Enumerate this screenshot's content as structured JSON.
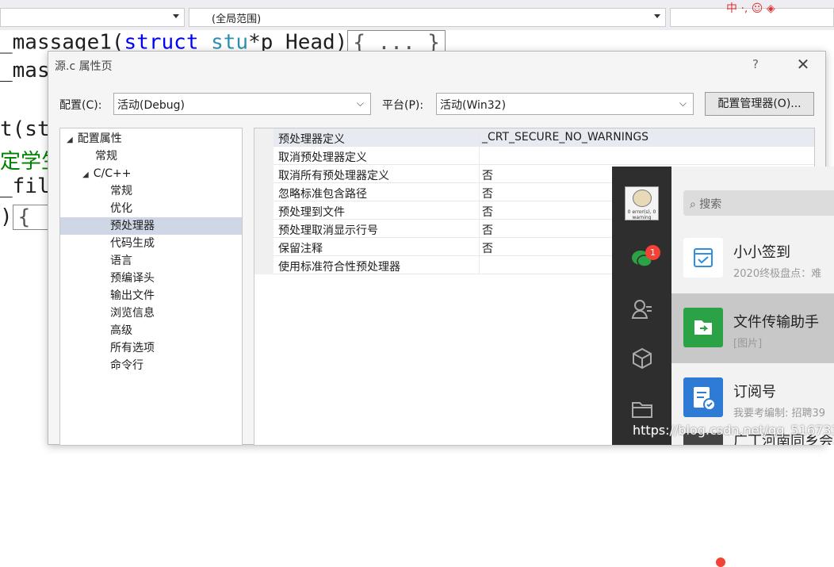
{
  "editor": {
    "scope_combo": "(全局范围)",
    "csdn_badge": "中 ·, ☺ ◈",
    "lines": [
      {
        "text": "_massage1(",
        "kw": "struct",
        "ty": "stu",
        "rest": "*p_Head)",
        "fold": "{ ... }"
      },
      {
        "text": "_mas"
      },
      {
        "text": "t(stu"
      },
      {
        "text": "定学生"
      },
      {
        "text": "_file"
      },
      {
        "text": ")",
        "fold": "{"
      }
    ]
  },
  "dialog": {
    "title": "源.c 属性页",
    "help": "?",
    "close": "✕",
    "config_label": "配置(C):",
    "config_value": "活动(Debug)",
    "platform_label": "平台(P):",
    "platform_value": "活动(Win32)",
    "config_manager_button": "配置管理器(O)...",
    "tree": [
      {
        "label": "配置属性",
        "level": 0,
        "expanded": true
      },
      {
        "label": "常规",
        "level": 1
      },
      {
        "label": "C/C++",
        "level": 1,
        "expanded": true
      },
      {
        "label": "常规",
        "level": 2
      },
      {
        "label": "优化",
        "level": 2
      },
      {
        "label": "预处理器",
        "level": 2,
        "selected": true
      },
      {
        "label": "代码生成",
        "level": 2
      },
      {
        "label": "语言",
        "level": 2
      },
      {
        "label": "预编译头",
        "level": 2
      },
      {
        "label": "输出文件",
        "level": 2
      },
      {
        "label": "浏览信息",
        "level": 2
      },
      {
        "label": "高级",
        "level": 2
      },
      {
        "label": "所有选项",
        "level": 2
      },
      {
        "label": "命令行",
        "level": 2
      }
    ],
    "properties": [
      {
        "name": "预处理器定义",
        "value": "_CRT_SECURE_NO_WARNINGS"
      },
      {
        "name": "取消预处理器定义",
        "value": ""
      },
      {
        "name": "取消所有预处理器定义",
        "value": "否"
      },
      {
        "name": "忽略标准包含路径",
        "value": "否"
      },
      {
        "name": "预处理到文件",
        "value": "否"
      },
      {
        "name": "预处理取消显示行号",
        "value": "否"
      },
      {
        "name": "保留注释",
        "value": "否"
      },
      {
        "name": "使用标准符合性预处理器",
        "value": ""
      }
    ]
  },
  "wechat": {
    "avatar_caption": "0 error(s), 0 warning",
    "chat_badge": "1",
    "search_placeholder": "搜索",
    "conversations": [
      {
        "name": "小小签到",
        "preview": "2020终极盘点：难",
        "thumb_color": "#ffffff",
        "icon": "calendar-check-icon"
      },
      {
        "name": "文件传输助手",
        "preview": "[图片]",
        "thumb_color": "#2ba245",
        "icon": "file-transfer-icon",
        "active": true
      },
      {
        "name": "订阅号",
        "preview": "我要考编制: 招聘39",
        "thumb_color": "#2e7bd6",
        "icon": "subscription-icon",
        "dot": true
      },
      {
        "name": "广丁河南同乡会",
        "preview": "",
        "thumb_color": "#444444",
        "icon": "group-avatar",
        "dot": true
      }
    ]
  },
  "watermark": "https://blog.csdn.net/qq_51673383"
}
